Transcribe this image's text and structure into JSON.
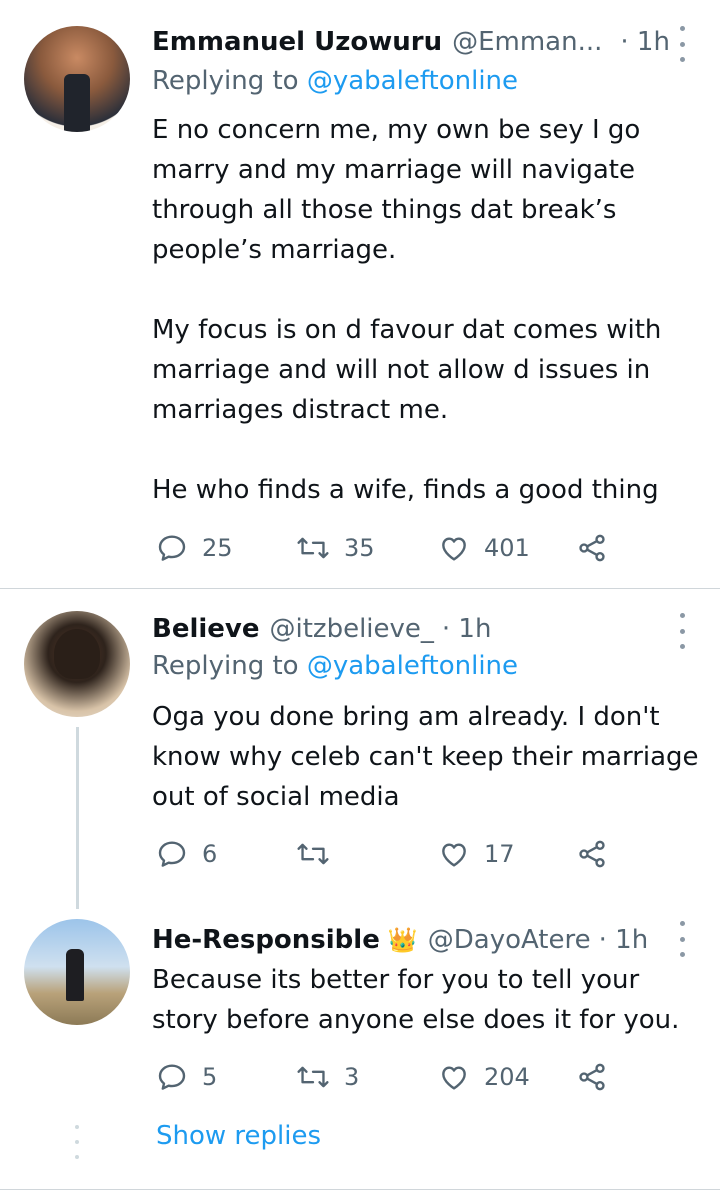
{
  "tweets": [
    {
      "name": "Emmanuel Uzowuru",
      "badge": "",
      "handle": "@Emman...",
      "time": "· 1h",
      "replying_prefix": "Replying to",
      "replying_to": "@yabaleftonline",
      "text": "E no concern me, my own be sey I go marry and my marriage will navigate through all those things dat break’s people’s marriage.\n\nMy focus is on d favour dat comes with marriage and will not allow d issues in marriages distract me.\n\nHe who finds a wife, finds a good thing",
      "replies": "25",
      "retweets": "35",
      "likes": "401"
    },
    {
      "name": "Believe",
      "badge": "",
      "handle": "@itzbelieve_",
      "time": "· 1h",
      "replying_prefix": "Replying to",
      "replying_to": "@yabaleftonline",
      "text": "Oga you done bring am already. I don't know why celeb can't keep their marriage out of social media",
      "replies": "6",
      "retweets": "",
      "likes": "17"
    },
    {
      "name": "He-Responsible",
      "badge": "👑",
      "handle": "@DayoAtere",
      "time": "· 1h",
      "text": "Because its better for you to tell your story before anyone else does it for you.",
      "replies": "5",
      "retweets": "3",
      "likes": "204"
    }
  ],
  "show_replies": "Show replies",
  "icons": {
    "reply": "reply-icon",
    "retweet": "retweet-icon",
    "like": "heart-icon",
    "share": "share-icon",
    "more": "more-vertical-icon"
  },
  "colors": {
    "link": "#1d9bf0",
    "secondary": "#536471",
    "text": "#0f1419"
  }
}
